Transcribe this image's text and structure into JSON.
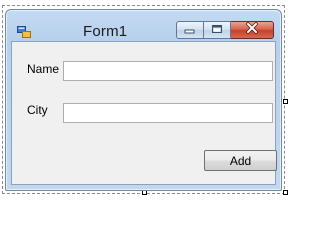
{
  "window": {
    "title": "Form1",
    "icon": "winforms-app-icon",
    "controls": {
      "minimize": "minimize-icon",
      "maximize": "maximize-icon",
      "close": "close-icon"
    },
    "colors": {
      "titlebar": "#b7d0ec",
      "client": "#f0f0f0",
      "close_button": "#c7402a"
    }
  },
  "form": {
    "name_label": "Name",
    "name_value": "",
    "city_label": "City",
    "city_value": "",
    "add_button": "Add"
  }
}
